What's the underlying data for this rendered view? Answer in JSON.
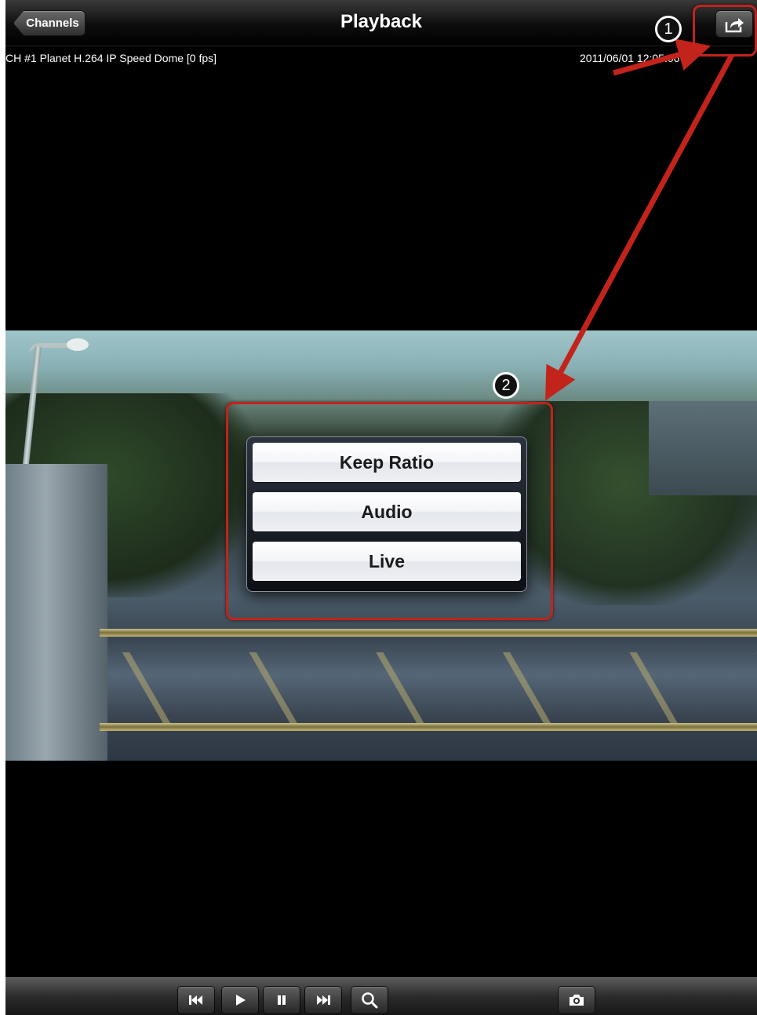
{
  "navbar": {
    "back_label": "Channels",
    "title": "Playback",
    "share_icon": "share-icon"
  },
  "info": {
    "channel": "CH #1 Planet H.264 IP Speed Dome [0 fps]",
    "timestamp": "2011/06/01 12:05:06"
  },
  "popover": {
    "items": [
      {
        "label": "Keep Ratio"
      },
      {
        "label": "Audio"
      },
      {
        "label": "Live"
      }
    ]
  },
  "toolbar": {
    "buttons": [
      {
        "icon": "skip-back-icon",
        "glyph": "⏮"
      },
      {
        "icon": "play-icon",
        "glyph": "▶"
      },
      {
        "icon": "pause-icon",
        "glyph": "❚❚"
      },
      {
        "icon": "skip-forward-icon",
        "glyph": "⏭"
      },
      {
        "icon": "search-icon",
        "glyph": ""
      },
      {
        "icon": "camera-icon",
        "glyph": ""
      }
    ]
  },
  "annotations": {
    "step1": "1",
    "step2": "2",
    "color": "#c2231b"
  }
}
